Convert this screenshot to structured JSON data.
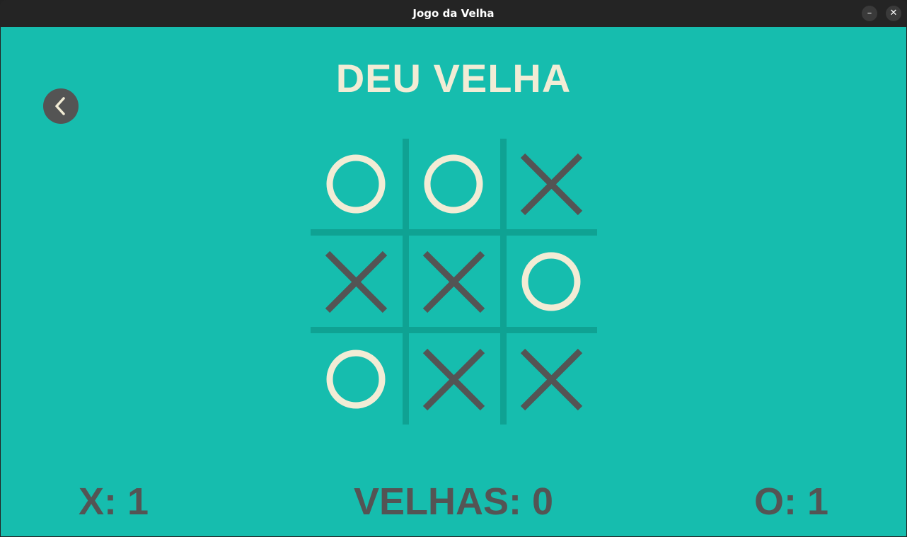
{
  "window": {
    "title": "Jogo da Velha",
    "minimize": "–",
    "close": "✕"
  },
  "back_icon": "chevron-left-icon",
  "result": "DEU VELHA",
  "board": [
    "O",
    "O",
    "X",
    "X",
    "X",
    "O",
    "O",
    "X",
    "X"
  ],
  "scores": {
    "x": "X: 1",
    "velhas": "VELHAS: 0",
    "o": "O: 1"
  },
  "colors": {
    "background": "#16bdae",
    "grid": "#0fa293",
    "x_mark": "#545454",
    "o_mark": "#f2ecd5",
    "button": "#545454"
  }
}
